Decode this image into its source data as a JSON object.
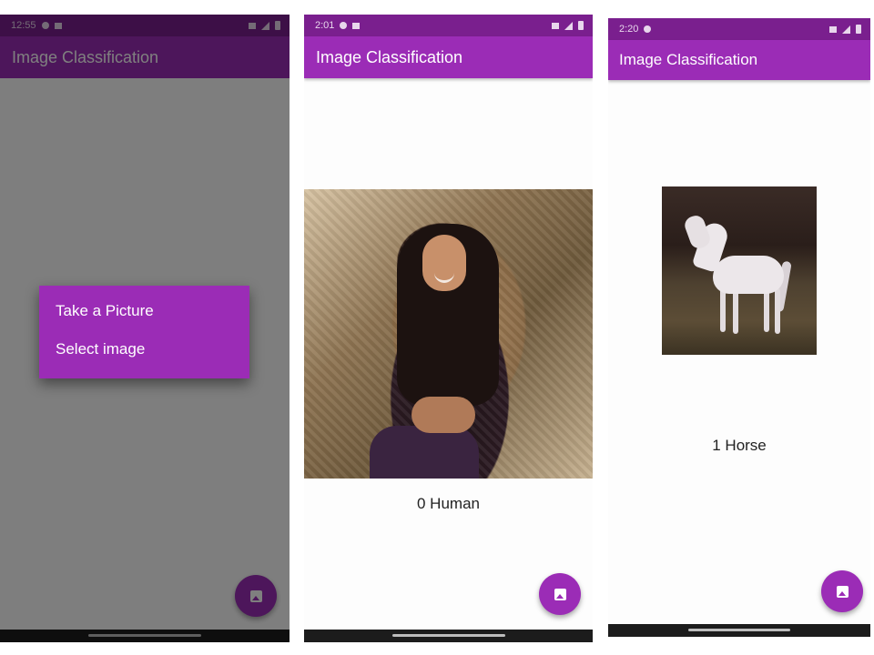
{
  "app": {
    "title": "Image Classification",
    "accent_color": "#9b2cb6",
    "status_bar_color": "#7a1f8e"
  },
  "screens": [
    {
      "status_time": "12:55",
      "popup_menu": {
        "items": [
          {
            "label": "Take a Picture"
          },
          {
            "label": "Select image"
          }
        ]
      },
      "fab_icon": "gallery-icon"
    },
    {
      "status_time": "2:01",
      "result_label": "0 Human",
      "fab_icon": "gallery-icon"
    },
    {
      "status_time": "2:20",
      "result_label": "1 Horse",
      "fab_icon": "gallery-icon"
    }
  ]
}
